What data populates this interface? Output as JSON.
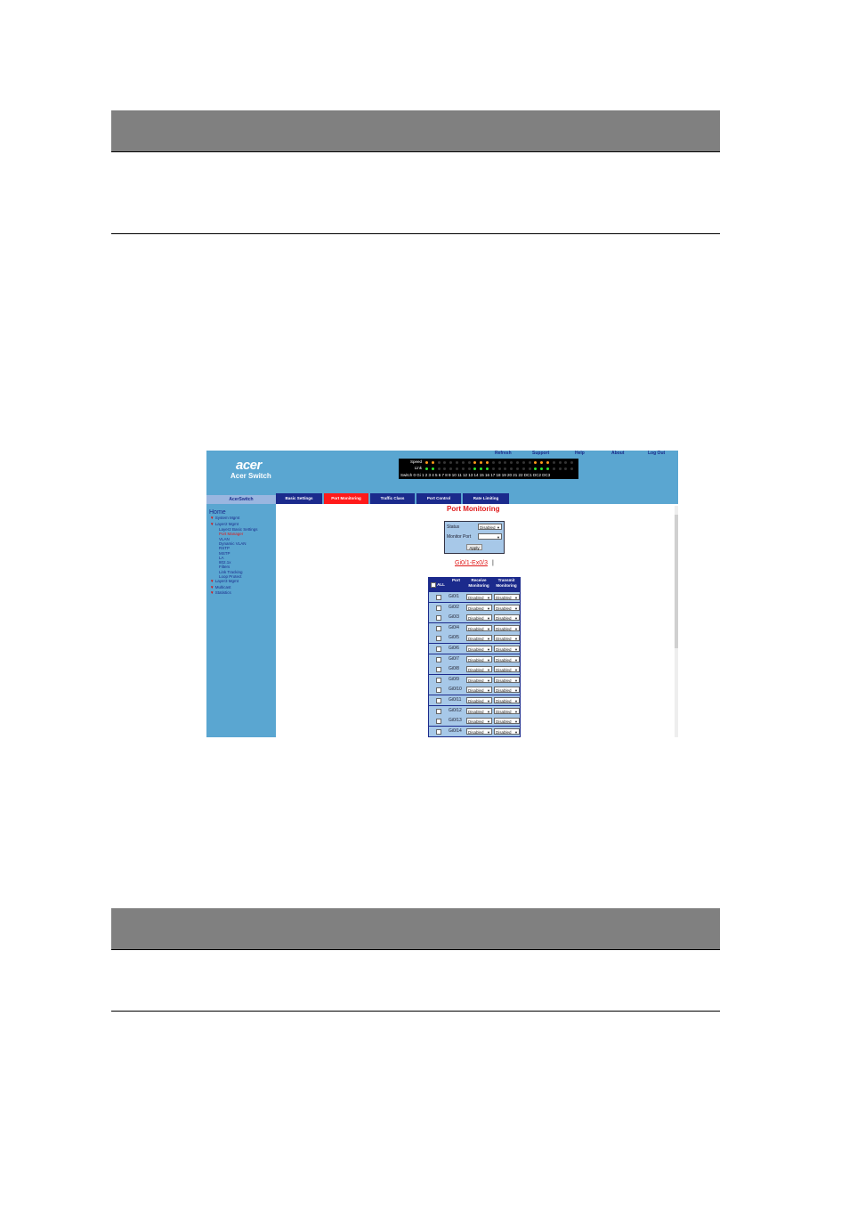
{
  "app": {
    "logo": "acer",
    "title": "Acer Switch",
    "top_links": [
      "Refresh",
      "Support",
      "Help",
      "About",
      "Log Out"
    ],
    "led_labels": [
      "Speed",
      "Link",
      "Switch 0"
    ],
    "led_ports": "Gi 1 2 3 4 5 6 7 8 9 10 11 12 13 14 15 16 17 18 19 20 21 22 DC1 DC2 DC3",
    "sidebar_title": "AcerSwitch",
    "tabs": [
      "Basic Settings",
      "Port Monitoring",
      "Traffic Class",
      "Port Control",
      "Rate Limiting"
    ],
    "active_tab": 1,
    "nav": [
      {
        "label": "Home",
        "level": 0
      },
      {
        "label": "System Mgmt",
        "level": 1
      },
      {
        "label": "Layer2 Mgmt",
        "level": 1
      },
      {
        "label": "Layer2 Basic Settings",
        "level": 2
      },
      {
        "label": "Port Manager",
        "level": 2,
        "selected": true
      },
      {
        "label": "VLAN",
        "level": 2
      },
      {
        "label": "Dynamic VLAN",
        "level": 2
      },
      {
        "label": "RSTP",
        "level": 2
      },
      {
        "label": "MSTP",
        "level": 2
      },
      {
        "label": "LA",
        "level": 2
      },
      {
        "label": "802.1x",
        "level": 2
      },
      {
        "label": "Filters",
        "level": 2
      },
      {
        "label": "Link Tracking",
        "level": 2
      },
      {
        "label": "Loop Protect",
        "level": 2
      },
      {
        "label": "Layer3 Mgmt",
        "level": 1
      },
      {
        "label": "Multicast",
        "level": 1
      },
      {
        "label": "Statistics",
        "level": 1
      }
    ]
  },
  "main": {
    "title": "Port Monitoring",
    "status_label": "Status",
    "status_value": "Disabled",
    "monitor_label": "Monitor Port",
    "apply_label": "Apply",
    "port_range": "Gi0/1-Ex0/3",
    "range_sep": "|",
    "table_headers": [
      "ALL",
      "Port",
      "Receive Monitoring",
      "Transmit Monitoring"
    ],
    "rows": [
      {
        "port": "Gi0/1",
        "rx": "Disabled",
        "tx": "Disabled"
      },
      {
        "port": "Gi0/2",
        "rx": "Disabled",
        "tx": "Disabled"
      },
      {
        "port": "Gi0/3",
        "rx": "Disabled",
        "tx": "Disabled"
      },
      {
        "port": "Gi0/4",
        "rx": "Disabled",
        "tx": "Disabled"
      },
      {
        "port": "Gi0/5",
        "rx": "Disabled",
        "tx": "Disabled"
      },
      {
        "port": "Gi0/6",
        "rx": "Disabled",
        "tx": "Disabled"
      },
      {
        "port": "Gi0/7",
        "rx": "Disabled",
        "tx": "Disabled"
      },
      {
        "port": "Gi0/8",
        "rx": "Disabled",
        "tx": "Disabled"
      },
      {
        "port": "Gi0/9",
        "rx": "Disabled",
        "tx": "Disabled"
      },
      {
        "port": "Gi0/10",
        "rx": "Disabled",
        "tx": "Disabled"
      },
      {
        "port": "Gi0/11",
        "rx": "Disabled",
        "tx": "Disabled"
      },
      {
        "port": "Gi0/12",
        "rx": "Disabled",
        "tx": "Disabled"
      },
      {
        "port": "Gi0/13",
        "rx": "Disabled",
        "tx": "Disabled"
      },
      {
        "port": "Gi0/14",
        "rx": "Disabled",
        "tx": "Disabled"
      }
    ]
  },
  "colors": {
    "header_blue": "#5aa6d1",
    "tab_navy": "#1b2a8c",
    "accent_red": "#e01a1a",
    "page_band_gray": "#808080"
  }
}
